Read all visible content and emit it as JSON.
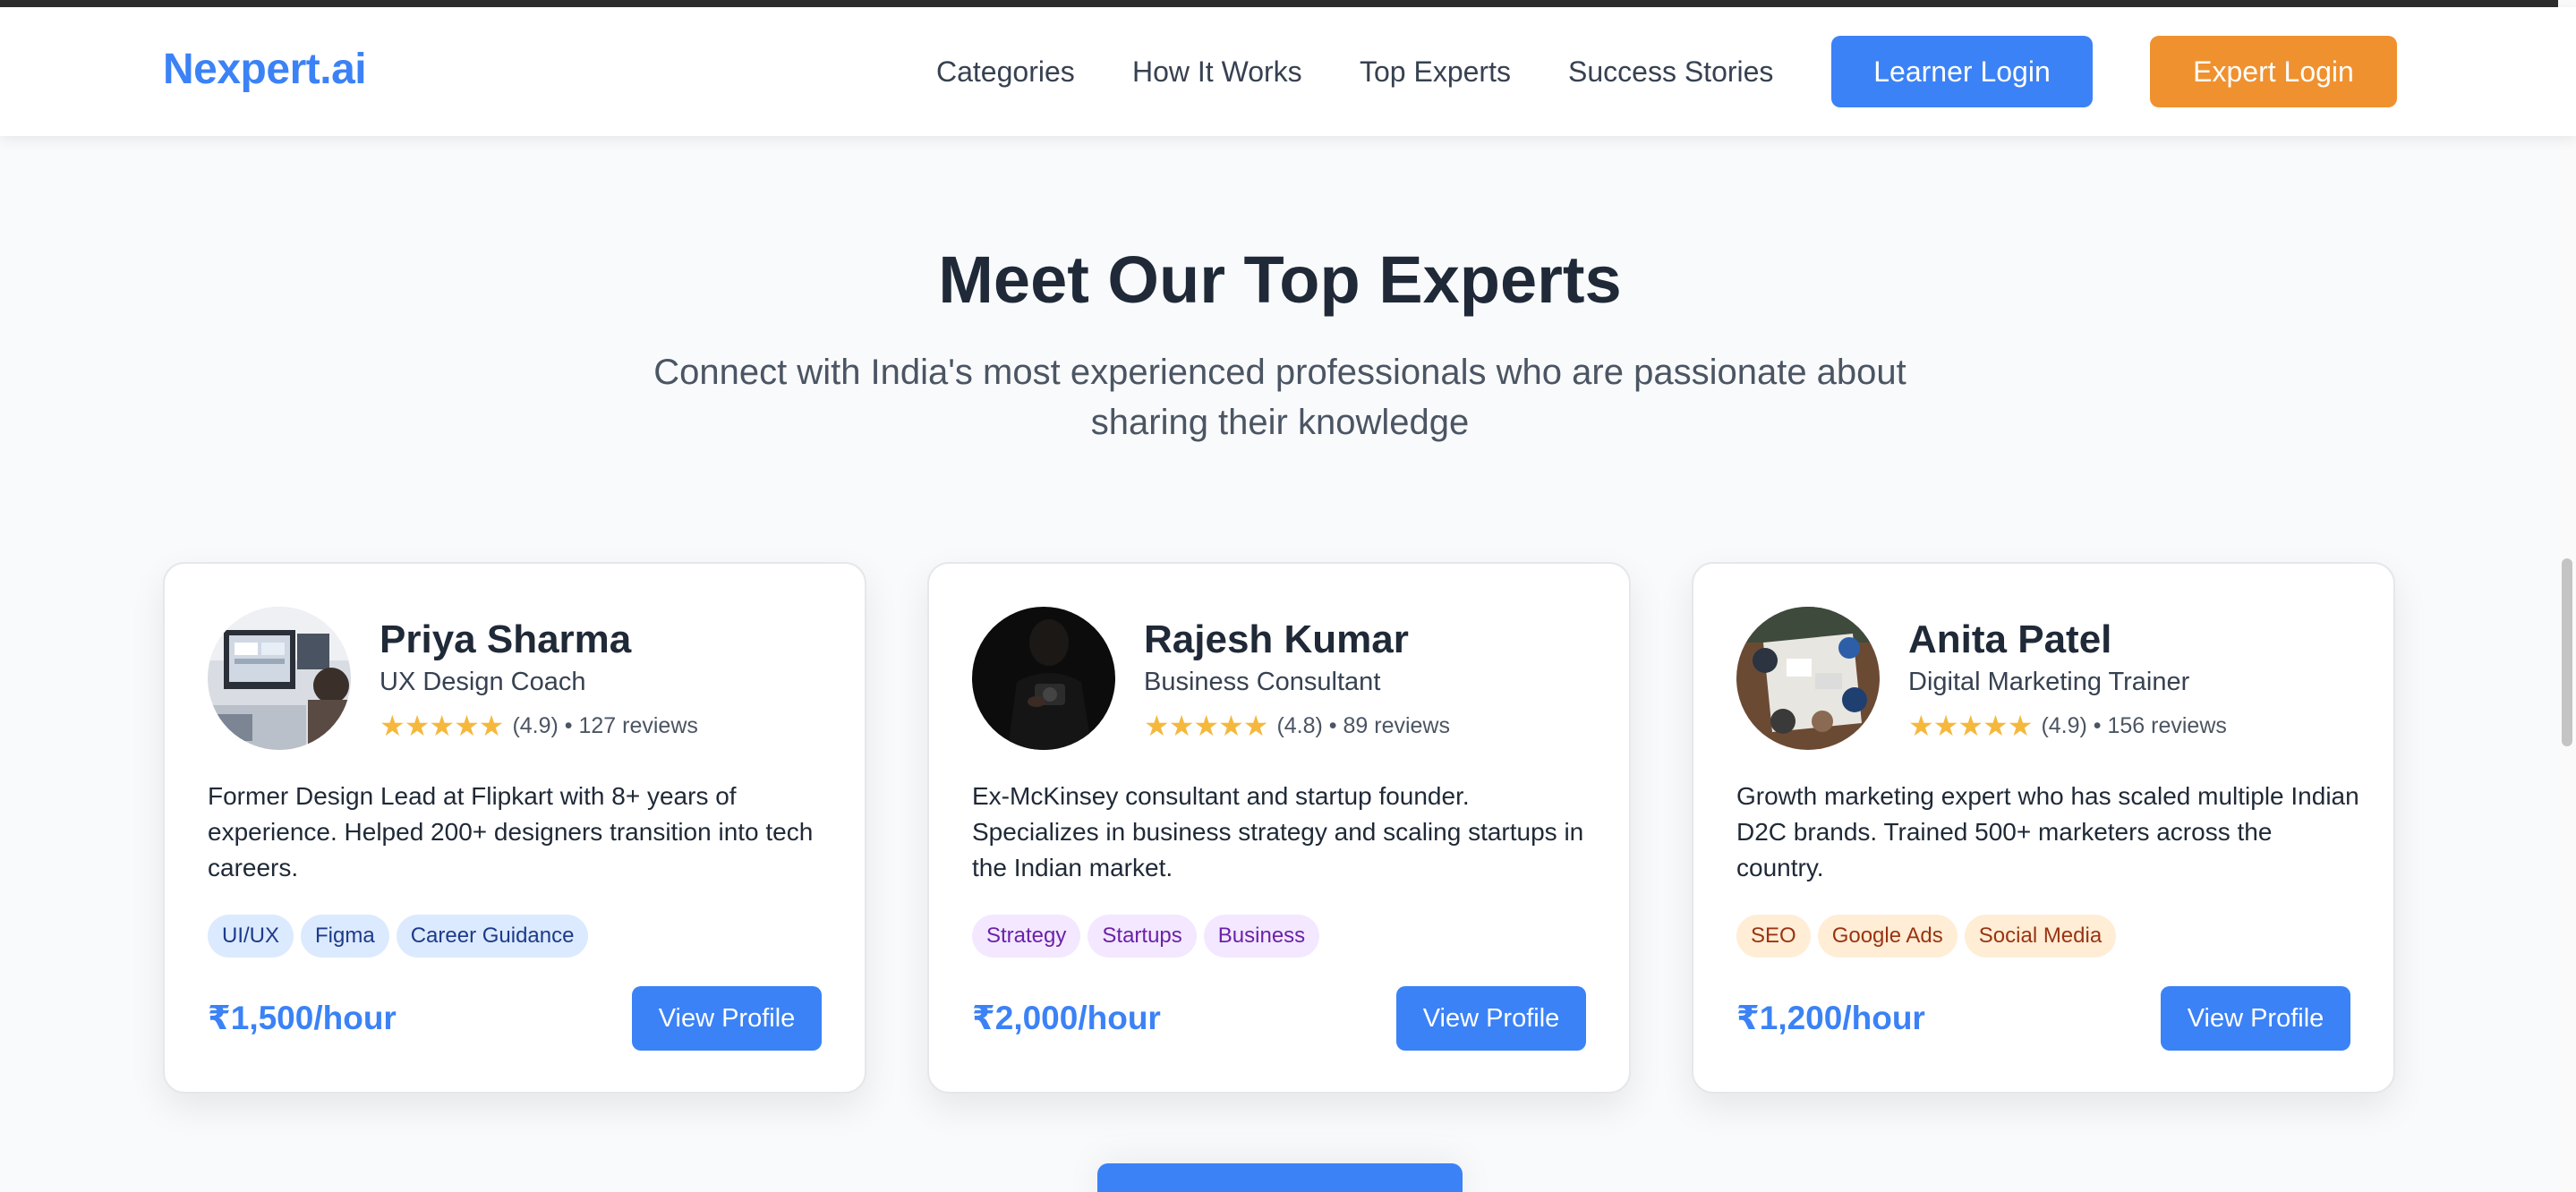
{
  "header": {
    "logo": "Nexpert.ai",
    "nav": [
      "Categories",
      "How It Works",
      "Top Experts",
      "Success Stories"
    ],
    "learner_login": "Learner Login",
    "expert_login": "Expert Login"
  },
  "section": {
    "title": "Meet Our Top Experts",
    "subtitle": "Connect with India's most experienced professionals who are passionate about sharing their knowledge"
  },
  "experts": [
    {
      "name": "Priya Sharma",
      "role": "UX Design Coach",
      "stars": "★★★★★",
      "rating": 4.9,
      "rating_text": "(4.9) • 127 reviews",
      "description": "Former Design Lead at Flipkart with 8+ years of experience. Helped 200+ designers transition into tech careers.",
      "tags": [
        "UI/UX",
        "Figma",
        "Career Guidance"
      ],
      "price": "₹1,500/hour",
      "cta": "View Profile"
    },
    {
      "name": "Rajesh Kumar",
      "role": "Business Consultant",
      "stars": "★★★★★",
      "rating": 4.8,
      "rating_text": "(4.8) • 89 reviews",
      "description": "Ex-McKinsey consultant and startup founder. Specializes in business strategy and scaling startups in the Indian market.",
      "tags": [
        "Strategy",
        "Startups",
        "Business"
      ],
      "price": "₹2,000/hour",
      "cta": "View Profile"
    },
    {
      "name": "Anita Patel",
      "role": "Digital Marketing Trainer",
      "stars": "★★★★★",
      "rating": 4.9,
      "rating_text": "(4.9) • 156 reviews",
      "description": "Growth marketing expert who has scaled multiple Indian D2C brands. Trained 500+ marketers across the country.",
      "tags": [
        "SEO",
        "Google Ads",
        "Social Media"
      ],
      "price": "₹1,200/hour",
      "cta": "View Profile"
    }
  ],
  "colors": {
    "primary": "#3b82f6",
    "accent_orange": "#f0912f",
    "star": "#f5b83d",
    "heading": "#1f2937"
  }
}
